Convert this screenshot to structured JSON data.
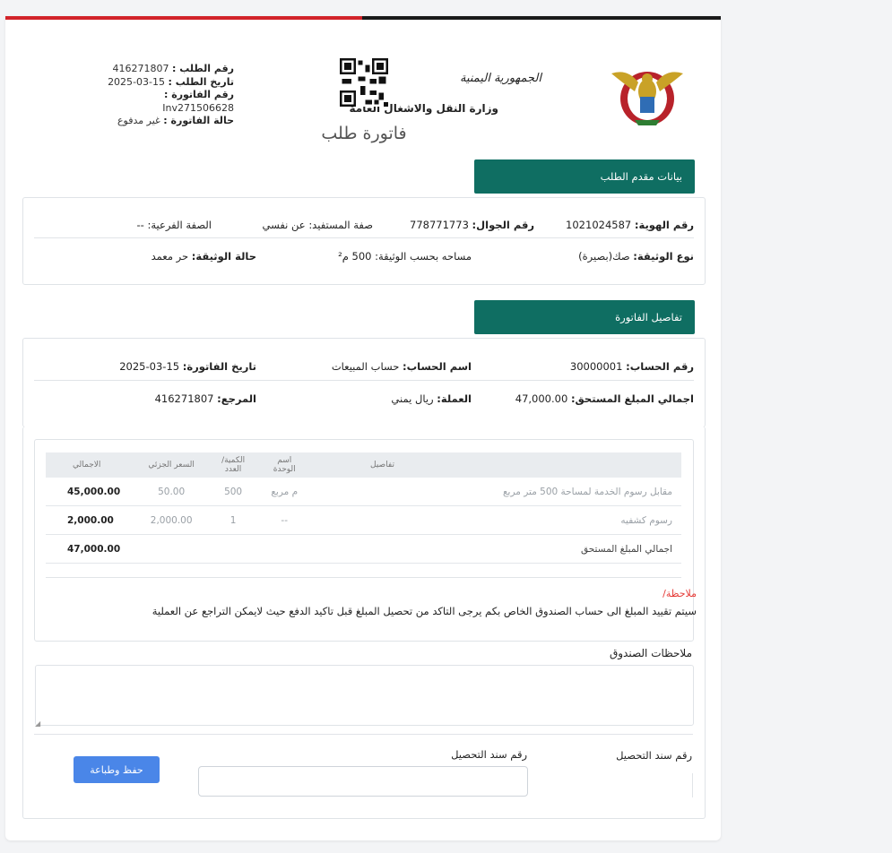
{
  "header": {
    "ministry_top": "الجمهورية اليمنية",
    "ministry_name": "وزارة النقل والاشغال العامة",
    "doc_title": "فاتورة طلب",
    "meta": {
      "request_no_label": "رقم الطلب :",
      "request_no": "416271807",
      "request_date_label": "تاريخ الطلب :",
      "request_date": "15-03-2025",
      "invoice_no_label": "رقم الفاتورة :",
      "invoice_no": "Inv271506628",
      "invoice_status_label": "حالة الفاتورة :",
      "invoice_status": "غير مدفوع"
    }
  },
  "applicant": {
    "tab": "بيانات مقدم الطلب",
    "id_label": "رقم الهوية:",
    "id": "1021024587",
    "phone_label": "رقم الجوال:",
    "phone": "778771773",
    "beneficiary_label": "صفة المستفيد:",
    "beneficiary": "عن نفسي",
    "subtype_label": "الصفة الفرعية:",
    "subtype": "--",
    "doc_type_label": "نوع الوثيقة:",
    "doc_type": "صك(بصيرة)",
    "area_label": "مساحه بحسب الوثيقة:",
    "area": "500 م²",
    "doc_status_label": "حالة الوثيقة:",
    "doc_status": "حر معمد"
  },
  "invoice": {
    "tab": "تفاصيل الفاتورة",
    "account_no_label": "رقم الحساب:",
    "account_no": "30000001",
    "account_name_label": "اسم الحساب:",
    "account_name": "حساب المبيعات",
    "invoice_date_label": "تاريخ الفاتورة:",
    "invoice_date": "15-03-2025",
    "total_due_label": "اجمالي المبلغ المستحق:",
    "total_due": "47,000.00",
    "currency_label": "العملة:",
    "currency": "ريال يمني",
    "ref_label": "المرجع:",
    "ref": "416271807"
  },
  "table": {
    "headers": [
      "تفاصيل",
      "اسم الوحدة",
      "الكمية/العدد",
      "السعر الجزئي",
      "الاجمالي"
    ],
    "rows": [
      [
        "مقابل رسوم الخدمة لمساحة 500 متر مربع",
        "م مربع",
        "500",
        "50.00",
        "45,000.00"
      ],
      [
        "رسوم كشفيه",
        "--",
        "1",
        "2,000.00",
        "2,000.00"
      ]
    ],
    "total_label": "اجمالي المبلغ المستحق",
    "total_value": "47,000.00"
  },
  "note": {
    "title": "ملاحظة/",
    "body": "سيتم تقييد المبلغ الى حساب الصندوق الخاص بكم يرجى التاكد من تحصيل المبلغ قبل تاكيد الدفع حيث لايمكن التراجع عن العملية"
  },
  "form": {
    "notes_label": "ملاحظات الصندوق",
    "receipt_label": "رقم سند التحصيل",
    "receipt_label_right": "رقم سند التحصيل",
    "save_button": "حفظ وطباعة"
  },
  "colors": {
    "accent": "#0f6e62",
    "button": "#4a86e8",
    "top_red": "#d2232a",
    "note_red": "#e53935"
  }
}
